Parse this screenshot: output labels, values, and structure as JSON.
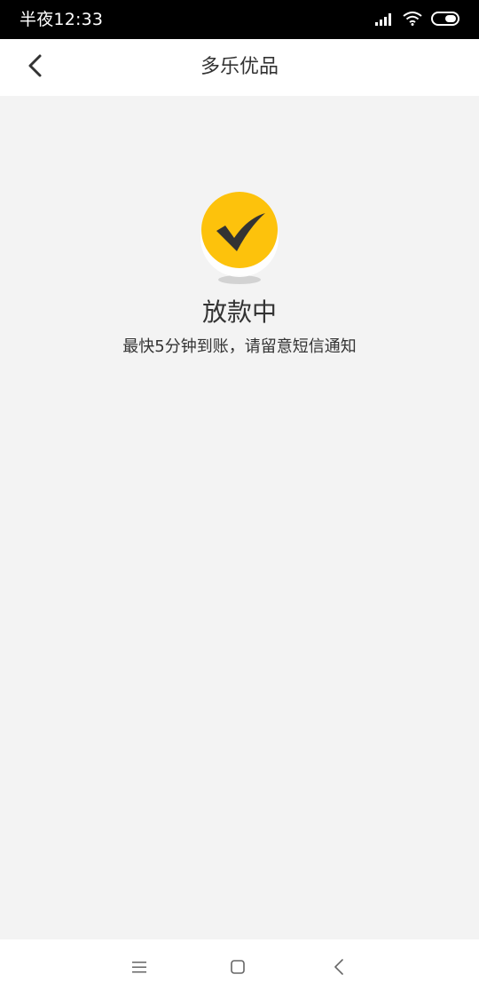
{
  "status_bar": {
    "time": "半夜12:33",
    "icons": [
      "signal-icon",
      "wifi-icon",
      "battery-icon"
    ]
  },
  "nav": {
    "title": "多乐优品",
    "back_icon": "chevron-left-icon"
  },
  "result": {
    "icon": "checkmark-icon",
    "title": "放款中",
    "description": "最快5分钟到账，请留意短信通知"
  },
  "system_nav": {
    "icons": [
      "menu-icon",
      "home-icon",
      "back-icon"
    ]
  },
  "colors": {
    "accent": "#fdc20c",
    "checkmark": "#333333",
    "background": "#f3f3f3",
    "text": "#333333"
  }
}
